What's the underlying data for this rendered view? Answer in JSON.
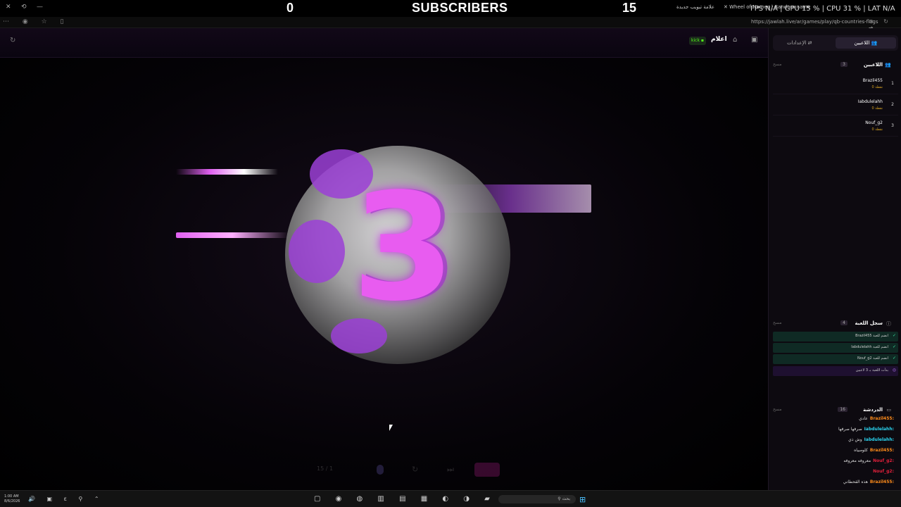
{
  "overlay": {
    "left_count": "0",
    "title": "SUBSCRIBERS",
    "right_count": "15",
    "stats": "FPS N/A | GPU 15 % | CPU 31 % | LAT N/A",
    "tab1": "علامة تبويب جديدة",
    "tab2": "Wheel of Names | Random name"
  },
  "address": {
    "url": "https://jawlah.live/ar/games/play/qb-countries-flags"
  },
  "header": {
    "title": "اعلام",
    "kick_label": "kick"
  },
  "stage": {
    "countdown": "3",
    "progress": "15 / 1"
  },
  "sidebar": {
    "tabs": {
      "players": "اللاعبين",
      "settings": "الإعدادات"
    },
    "players_section": {
      "title": "اللاعبين",
      "count": "3",
      "clear": "مسح"
    },
    "players": [
      {
        "name": "Brazil455",
        "score": "0 نقطة",
        "rank": "1"
      },
      {
        "name": "Iabdulelahh",
        "score": "0 نقطة",
        "rank": "2"
      },
      {
        "name": "Nouf_g2",
        "score": "0 نقطة",
        "rank": "3"
      }
    ],
    "log_section": {
      "title": "سجل اللعبة",
      "count": "4",
      "clear": "مسح"
    },
    "log": [
      {
        "text": "Brazil455 انضم للعبة",
        "kind": "join"
      },
      {
        "text": "Iabdulelahh انضم للعبة",
        "kind": "join"
      },
      {
        "text": "Nouf_g2 انضم للعبة",
        "kind": "join"
      },
      {
        "text": "بدأت اللعبة بـ 3 لاعبين",
        "kind": "start"
      }
    ],
    "chat_section": {
      "title": "الدردشة",
      "count": "16",
      "clear": "مسح"
    },
    "chat": [
      {
        "user": "Brazil455:",
        "msg": "عادي",
        "color": "#ff8c1a"
      },
      {
        "user": "Iabdulelahh:",
        "msg": "صرفها صرفها",
        "color": "#2ad4f0"
      },
      {
        "user": "Iabdulelahh:",
        "msg": "وش ذي",
        "color": "#2ad4f0"
      },
      {
        "user": "Brazil455:",
        "msg": "كلومبياه",
        "color": "#ff8c1a"
      },
      {
        "user": "Nouf_g2:",
        "msg": "معروفه معروفه",
        "color": "#e0203a"
      },
      {
        "user": "Nouf_g2:",
        "msg": "",
        "color": "#e0203a"
      },
      {
        "user": "Brazil455:",
        "msg": "هذه القحطاني",
        "color": "#ff8c1a"
      }
    ]
  },
  "taskbar": {
    "time": "1:00 AM",
    "date": "8/6/2026",
    "search_placeholder": "بحث"
  },
  "colors": {
    "accent": "#e85cf0",
    "kick": "#53fc18",
    "stop": "#d020a0"
  }
}
